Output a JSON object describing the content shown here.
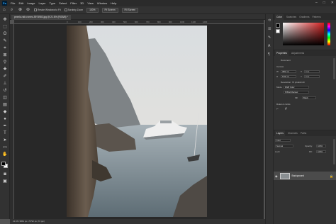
{
  "menu": {
    "logo": "Ps",
    "items": [
      "File",
      "Edit",
      "Image",
      "Layer",
      "Type",
      "Select",
      "Filter",
      "3D",
      "View",
      "Window",
      "Help"
    ],
    "window_controls": [
      "–",
      "□",
      "✕"
    ]
  },
  "options_bar": {
    "checkbox_resize": "Resize Windows to Fit",
    "checkbox_scrubby": "Scrubby Zoom",
    "zoom_value": "100%",
    "fit_screen": "Fit Screen",
    "fill_screen": "Fill Screen"
  },
  "document": {
    "tab_title": "pexels-ruth-romeo-5974983.jpg @ 21.6% (RGB/8) *",
    "status": "21.6%   3864 px x 5792 px (72 ppi)"
  },
  "ruler": {
    "ticks": [
      "0",
      "100",
      "200",
      "300",
      "400",
      "500",
      "600",
      "700",
      "800",
      "900",
      "1000",
      "1100",
      "1200"
    ]
  },
  "panels": {
    "color_tabs": [
      "Color",
      "Swatches",
      "Gradients",
      "Patterns"
    ],
    "colors": {
      "foreground": "#d21f1f",
      "accent": "#31a8ff"
    },
    "properties_tabs": [
      "Properties",
      "Adjustments"
    ],
    "properties": {
      "document_label": "Document",
      "canvas_label": "Canvas",
      "width": "3864 px",
      "height": "5792 px",
      "x": "0 px",
      "y": "0 px",
      "resolution": "Resolution: 72 pixels/inch",
      "mode_label": "Mode",
      "mode_value": "RGB Color",
      "depth_value": "8 Bits/Channel",
      "fill_label": "Fill",
      "fill_value": "Black",
      "rulers_label": "Rulers & Grids"
    },
    "layers_tabs": [
      "Layers",
      "Channels",
      "Paths"
    ],
    "layers": {
      "kind_label": "Kind",
      "blend_mode": "Normal",
      "opacity_label": "Opacity:",
      "opacity_value": "100%",
      "lock_label": "Lock:",
      "fill_label": "Fill:",
      "fill_value": "100%",
      "layer_name": "Background"
    }
  }
}
